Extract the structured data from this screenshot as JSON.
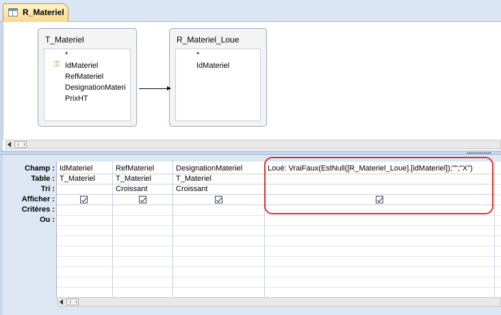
{
  "tab": {
    "title": "R_Materiel"
  },
  "tables": [
    {
      "title": "T_Materiel",
      "fields": [
        "*",
        "IdMateriel",
        "RefMateriel",
        "DesignationMateri",
        "PrixHT"
      ],
      "key_field_index": 1
    },
    {
      "title": "R_Materiel_Loue",
      "fields": [
        "*",
        "IdMateriel"
      ]
    }
  ],
  "grid": {
    "row_labels": [
      "Champ :",
      "Table :",
      "Tri :",
      "Afficher :",
      "Critères :",
      "Ou :"
    ],
    "columns": [
      {
        "champ": "IdMateriel",
        "table": "T_Materiel",
        "tri": "",
        "afficher": true
      },
      {
        "champ": "RefMateriel",
        "table": "T_Materiel",
        "tri": "Croissant",
        "afficher": true
      },
      {
        "champ": "DesignationMateriel",
        "table": "T_Materiel",
        "tri": "Croissant",
        "afficher": true
      },
      {
        "champ": "Loué: VraiFaux(EstNull([R_Materiel_Loue].[idMateriel]);\"\";\"X\")",
        "table": "",
        "tri": "",
        "afficher": true
      }
    ]
  },
  "colors": {
    "highlight": "#d9312c",
    "tab_bg": "#f9d98a",
    "grid_bg": "#dde7f3"
  }
}
